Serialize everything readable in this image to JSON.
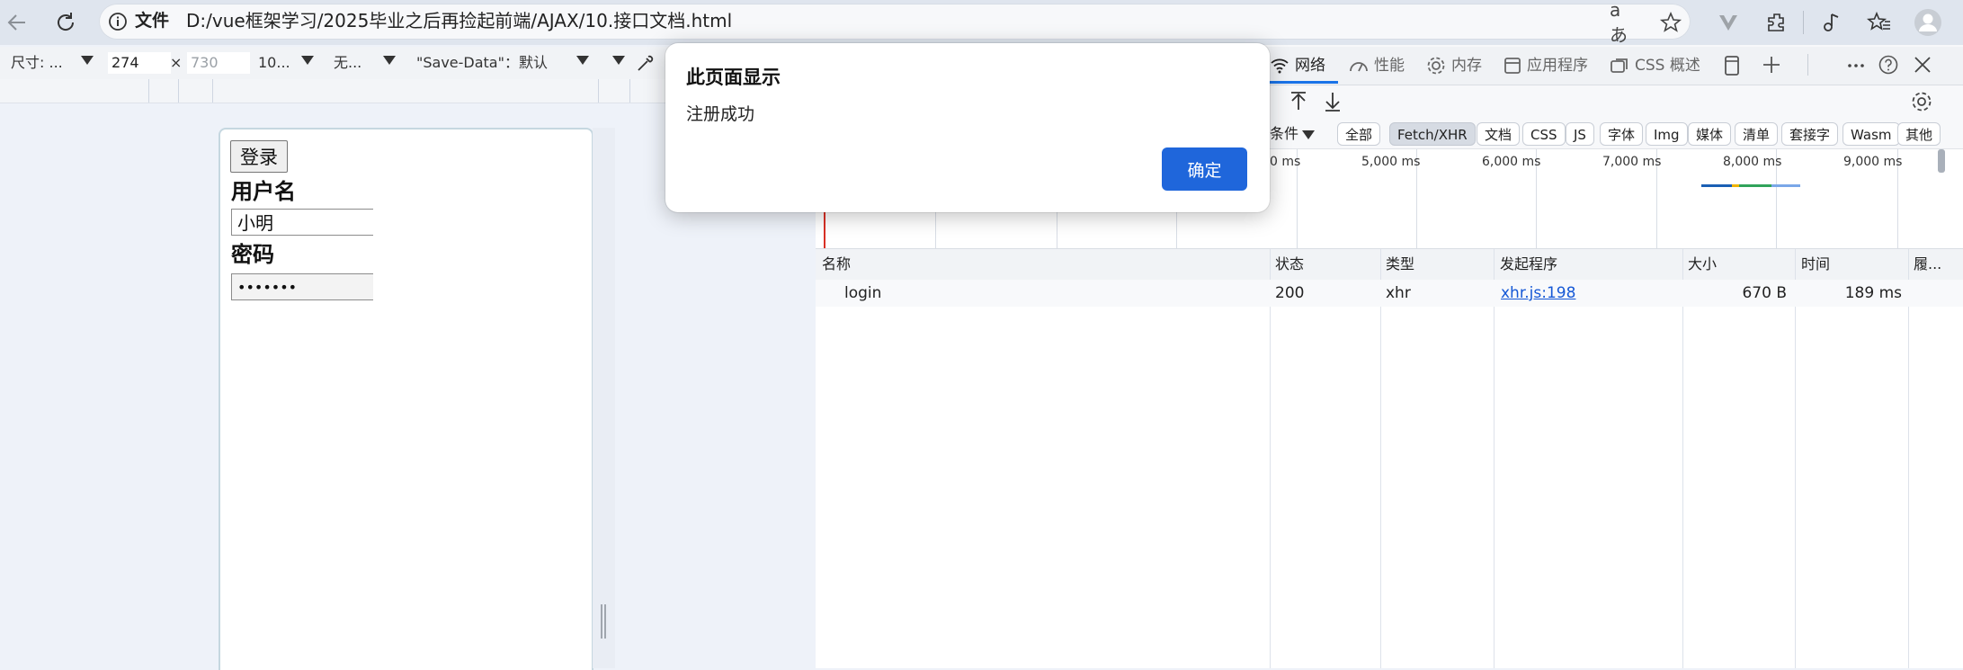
{
  "browser": {
    "file_label": "文件",
    "url": "D:/vue框架学习/2025毕业之后再捡起前端/AJAX/10.接口文档.html",
    "read_aloud_glyph": "aあ"
  },
  "device_toolbar": {
    "size_label": "尺寸: ...",
    "width": "274",
    "times": "×",
    "height_placeholder": "730",
    "zoom": "10...",
    "throttle": "无...",
    "save_data": "\"Save-Data\"：默认"
  },
  "page": {
    "login_button": "登录",
    "username_label": "用户名",
    "username_value": "小明",
    "password_label": "密码",
    "password_value": "•••••••"
  },
  "devtools": {
    "tabs": [
      "网络",
      "性能",
      "内存",
      "应用程序",
      "CSS 概述"
    ],
    "active_tab": "网络",
    "filter_prefix": "条件",
    "filter_chips": [
      "全部",
      "Fetch/XHR",
      "文档",
      "CSS",
      "JS",
      "字体",
      "Img",
      "媒体",
      "清单",
      "套接字",
      "Wasm",
      "其他"
    ],
    "active_chip": "Fetch/XHR",
    "timeline_labels": [
      "0 ms",
      "5,000 ms",
      "6,000 ms",
      "7,000 ms",
      "8,000 ms",
      "9,000 ms"
    ],
    "columns": [
      "名称",
      "状态",
      "类型",
      "发起程序",
      "大小",
      "时间",
      "履..."
    ],
    "rows": [
      {
        "name": "login",
        "status": "200",
        "type": "xhr",
        "initiator": "xhr.js:198",
        "size": "670 B",
        "time": "189 ms"
      }
    ]
  },
  "dialog": {
    "title": "此页面显示",
    "message": "注册成功",
    "ok_label": "确定",
    "ok_color": "#1f66db"
  }
}
